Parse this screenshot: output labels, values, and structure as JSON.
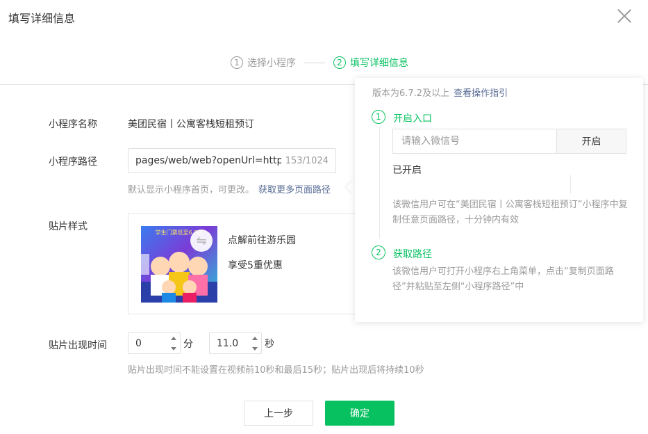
{
  "dialog": {
    "title": "填写详细信息"
  },
  "steps": [
    {
      "num": "1",
      "label": "选择小程序"
    },
    {
      "num": "2",
      "label": "填写详细信息"
    }
  ],
  "form": {
    "name_label": "小程序名称",
    "name_value": "美团民宿丨公寓客栈短租预订",
    "path_label": "小程序路径",
    "path_value": "pages/web/web?openUrl=https%",
    "path_counter": "153/1024",
    "path_hint": "默认显示小程序首页，可更改。",
    "path_hint_link": "获取更多页面路径",
    "card_label": "贴片样式",
    "card_title": "点解前往游乐园",
    "card_sub": "享受5重优惠",
    "thumb_caption": "学生门票低至6.5折",
    "time_label": "贴片出现时间",
    "minutes_value": "0",
    "minutes_unit": "分",
    "seconds_value": "11.0",
    "seconds_unit": "秒",
    "time_hint": "贴片出现时间不能设置在视频前10秒和最后15秒；贴片出现后将持续10秒"
  },
  "buttons": {
    "prev": "上一步",
    "confirm": "确定"
  },
  "popover": {
    "version_text": "版本为6.7.2及以上",
    "guide_link": "查看操作指引",
    "step1_num": "1",
    "step1_title": "开启入口",
    "wechat_placeholder": "请输入微信号",
    "open_button": "开启",
    "enabled_text": "已开启",
    "step1_desc": "该微信用户可在“美团民宿丨公寓客栈短租预订”小程序中复制任意页面路径，十分钟内有效",
    "step2_num": "2",
    "step2_title": "获取路径",
    "step2_desc": "该微信用户可打开小程序右上角菜单，点击“复制页面路径”并粘贴至左侧“小程序路径”中"
  },
  "colors": {
    "accent": "#07c160",
    "link": "#576b95",
    "muted": "#9a9a9a",
    "text": "#353535"
  },
  "icons": {
    "close": "close-icon",
    "swap": "swap-icon"
  }
}
